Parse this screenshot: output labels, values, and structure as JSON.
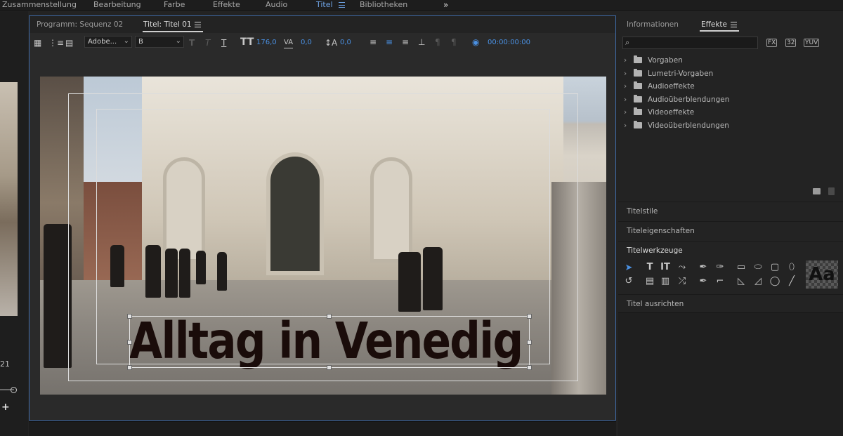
{
  "workspaces": {
    "items": [
      "Zusammenstellung",
      "Bearbeitung",
      "Farbe",
      "Effekte",
      "Audio",
      "Titel",
      "Bibliotheken"
    ],
    "active": "Titel",
    "more_icon": "double-chevron-right-icon"
  },
  "left_panel": {
    "timecode_fragment": "21",
    "add_icon": "+"
  },
  "title_panel": {
    "tab_program": "Programm: Sequenz 02",
    "tab_title": "Titel: Titel 01",
    "font_family": "Adobe...",
    "font_style": "B",
    "font_size": "176,0",
    "kerning": "0,0",
    "leading": "0,0",
    "timecode": "00:00:00:00",
    "title_text": "Alltag in Venedig"
  },
  "right_panel": {
    "tab_info": "Informationen",
    "tab_effects": "Effekte",
    "search_placeholder": "",
    "icon_labels": [
      "",
      "32",
      "YUV"
    ],
    "tree": [
      "Vorgaben",
      "Lumetri-Vorgaben",
      "Audioeffekte",
      "Audioüberblendungen",
      "Videoeffekte",
      "Videoüberblendungen"
    ],
    "sections": {
      "titelstile": "Titelstile",
      "titeleigenschaften": "Titeleigenschaften",
      "titelwerkzeuge": "Titelwerkzeuge",
      "titel_ausrichten": "Titel ausrichten"
    },
    "style_swatch": "Aa"
  },
  "colors": {
    "accent": "#4a90e2",
    "panel_border": "#3f6aa6",
    "title_text": "#1a0c0a"
  }
}
